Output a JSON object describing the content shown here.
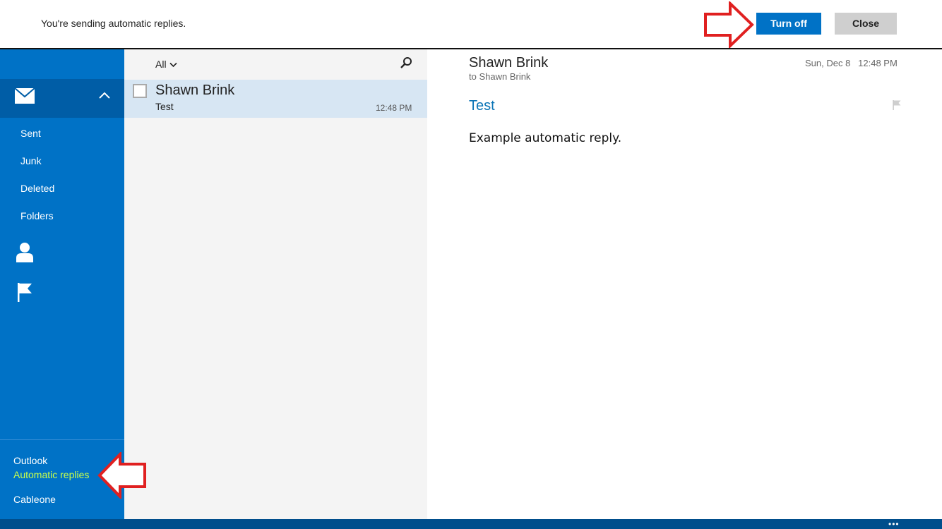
{
  "notification": {
    "message": "You're sending automatic replies.",
    "turn_off_label": "Turn off",
    "close_label": "Close"
  },
  "sidebar": {
    "icons": [
      "mail-icon",
      "chevron-up-icon",
      "people-icon",
      "flag-icon"
    ],
    "folders": [
      "Sent",
      "Junk",
      "Deleted",
      "Folders"
    ],
    "accounts": {
      "outlook": "Outlook",
      "automatic_replies": "Automatic replies",
      "cableone": "Cableone"
    }
  },
  "message_list": {
    "filter_label": "All",
    "messages": [
      {
        "sender": "Shawn Brink",
        "subject": "Test",
        "time": "12:48 PM"
      }
    ]
  },
  "reading_pane": {
    "from": "Shawn Brink",
    "to": "to Shawn Brink",
    "date": "Sun, Dec 8   12:48 PM",
    "subject": "Test",
    "body": "Example automatic reply."
  },
  "app_bar": {
    "more_label": "•••"
  },
  "colors": {
    "accent": "#0072c6",
    "sidebar_selected": "#005da6",
    "selected_message": "#d7e6f3",
    "subject_link": "#0a74b6",
    "highlight_text": "#c8ff4a",
    "annotation_arrow": "#e02020"
  }
}
